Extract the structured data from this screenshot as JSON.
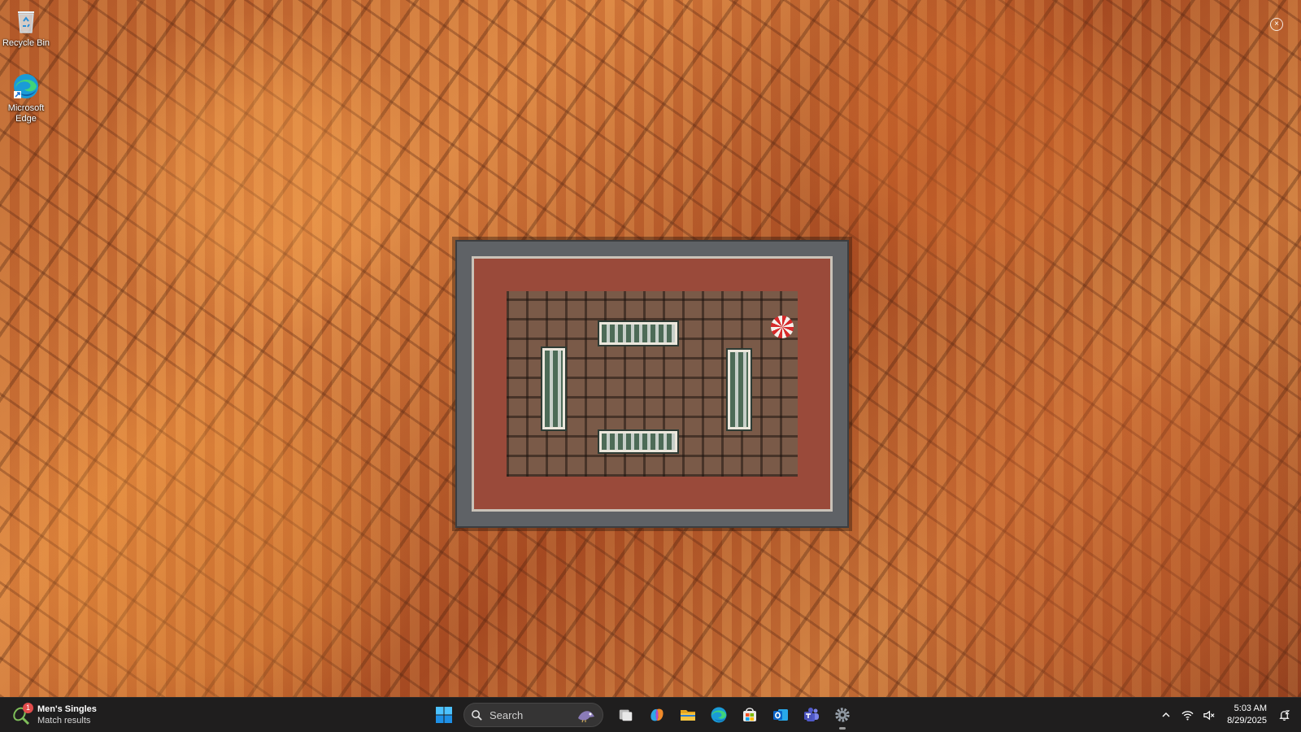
{
  "desktop": {
    "icons": [
      {
        "label": "Recycle Bin",
        "icon": "recycle-bin-icon"
      },
      {
        "label": "Microsoft Edge",
        "icon": "edge-icon"
      }
    ],
    "wallpaper": "aerial-city-square"
  },
  "taskbar": {
    "widget": {
      "title": "Men's Singles",
      "subtitle": "Match results",
      "badge": "1",
      "icon": "tennis-icon"
    },
    "search": {
      "label": "Search"
    },
    "apps": [
      {
        "name": "start",
        "icon": "windows-start-icon"
      },
      {
        "name": "task-view",
        "icon": "task-view-icon"
      },
      {
        "name": "copilot",
        "icon": "copilot-icon"
      },
      {
        "name": "file-explorer",
        "icon": "folder-icon"
      },
      {
        "name": "edge",
        "icon": "edge-icon"
      },
      {
        "name": "store",
        "icon": "store-icon"
      },
      {
        "name": "outlook",
        "icon": "outlook-icon"
      },
      {
        "name": "teams",
        "icon": "teams-icon"
      },
      {
        "name": "settings",
        "icon": "gear-icon"
      }
    ],
    "tray": {
      "time": "5:03 AM",
      "date": "8/29/2025"
    }
  },
  "colors": {
    "taskbar_bg": "#1f1e1e",
    "accent_blue": "#0a84ff",
    "badge_red": "#e24c4c"
  }
}
